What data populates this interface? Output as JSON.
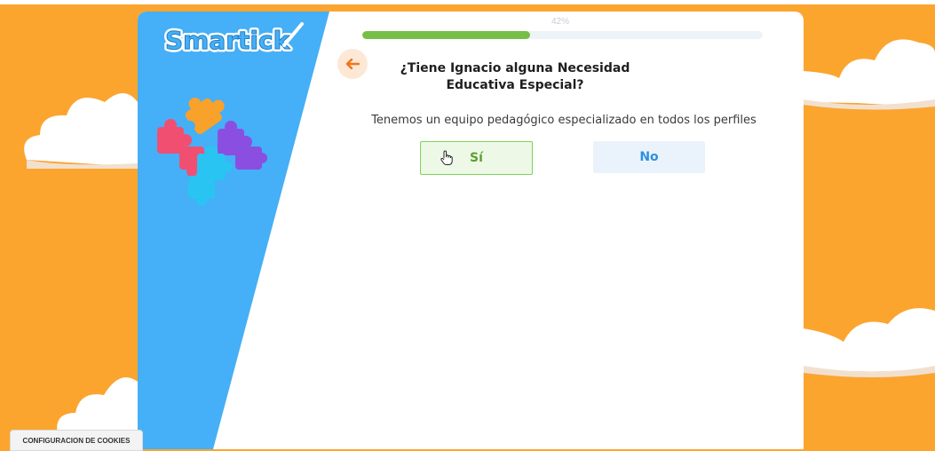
{
  "brand": {
    "logo_text": "Smartick"
  },
  "progress": {
    "percent": 42,
    "label": "42%"
  },
  "question": {
    "title": "¿Tiene Ignacio alguna Necesidad Educativa Especial?"
  },
  "subtitle": "Tenemos un equipo pedagógico especializado en todos los perfiles",
  "options": {
    "yes": "Sí",
    "no": "No"
  },
  "cookies": {
    "label": "CONFIGURACION DE COOKIES"
  },
  "colors": {
    "background": "#fba52f",
    "panel_blue": "#45aff7",
    "progress": "#76bf46",
    "back_arrow": "#f2741a"
  },
  "icons": {
    "back": "arrow-left-icon",
    "cursor": "hand-pointer-icon",
    "illustration": "puzzle-pieces-icon"
  }
}
